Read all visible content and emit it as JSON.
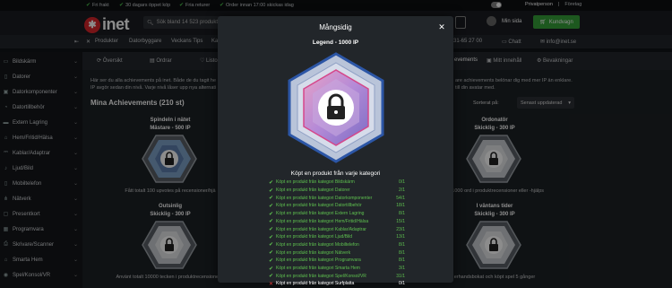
{
  "promo": {
    "items": [
      "Fri frakt",
      "30 dagars öppet köp",
      "Fria returer",
      "Order innan 17:00 skickas idag"
    ],
    "right": [
      "Privatperson",
      "Företag"
    ]
  },
  "header": {
    "logo_text": "inet",
    "search_placeholder": "Sök bland 14 523 produkt",
    "my_page": "Min sida",
    "cart_label": "Kundvagn"
  },
  "navbar": {
    "items": [
      "Produkter",
      "Datorbyggare",
      "Veckans Tips",
      "Ka"
    ],
    "phone": "31-65 27 00",
    "chat": "Chatt",
    "email": "info@inet.se"
  },
  "sidebar": {
    "items": [
      {
        "label": "Bildskärm",
        "icon": "monitor-icon"
      },
      {
        "label": "Datorer",
        "icon": "computer-icon"
      },
      {
        "label": "Datorkomponenter",
        "icon": "cpu-icon"
      },
      {
        "label": "Datortillbehör",
        "icon": "mouse-icon"
      },
      {
        "label": "Extern Lagring",
        "icon": "drive-icon"
      },
      {
        "label": "Hem/Fritid/Hälsa",
        "icon": "home-icon"
      },
      {
        "label": "Kablar/Adaptrar",
        "icon": "cable-icon"
      },
      {
        "label": "Ljud/Bild",
        "icon": "speaker-icon"
      },
      {
        "label": "Mobiltelefon",
        "icon": "phone-icon"
      },
      {
        "label": "Nätverk",
        "icon": "network-icon"
      },
      {
        "label": "Presentkort",
        "icon": "gift-icon"
      },
      {
        "label": "Programvara",
        "icon": "software-icon"
      },
      {
        "label": "Skrivare/Scanner",
        "icon": "printer-icon"
      },
      {
        "label": "Smarta Hem",
        "icon": "smart-home-icon"
      },
      {
        "label": "Spel/Konsol/VR",
        "icon": "gamepad-icon"
      }
    ]
  },
  "tabs": {
    "overview": "Översikt",
    "orders": "Ordrar",
    "wishlist": "Listo",
    "achievements": "evements",
    "my_content": "Mitt innehåll",
    "watch": "Bevakningar"
  },
  "main": {
    "intro_left_1": "Här ser du alla achievements på inet. Både de du tagit he",
    "intro_left_2": "IP avgör sedan din nivå. Varje nivå låser upp nya alternati",
    "intro_right_1": "are achievements belönar dig med mer IP än enklare.",
    "intro_right_2": "till din avatar med.",
    "heading": "Mina Achievements (210 st)",
    "sort_label": "Sorterat på:",
    "sort_value": "Senast uppdaterad"
  },
  "cards": [
    {
      "title": "Spindeln i nätet",
      "level": "Mästare - 500 IP",
      "desc": "Fått totalt 100 upvotes på recensioner/hjä"
    },
    {
      "title": "Ordonatör",
      "level": "Skicklig - 300 IP",
      "desc": "ök 1000 ord i produktrecensioner eller -hjälps"
    },
    {
      "title": "Outsinlig",
      "level": "Skicklig - 300 IP",
      "desc": "Använt totalt 10000 tecken i produktrecensioner e"
    },
    {
      "title": "I väntans tider",
      "level": "Skicklig - 300 IP",
      "desc": "erhandsbokat och köpt spel 5 gånger"
    }
  ],
  "modal": {
    "title": "Mångsidig",
    "subtitle": "Legend - 1000 IP",
    "description": "Köpt en produkt från varje kategori",
    "requirements": [
      {
        "label": "Köpt en produkt från kategori Bildskärm",
        "count": "0/1",
        "done": true
      },
      {
        "label": "Köpt en produkt från kategori Datorer",
        "count": "2/1",
        "done": true
      },
      {
        "label": "Köpt en produkt från kategori Datorkomponenter",
        "count": "54/1",
        "done": true
      },
      {
        "label": "Köpt en produkt från kategori Datortillbehör",
        "count": "18/1",
        "done": true
      },
      {
        "label": "Köpt en produkt från kategori Extern Lagring",
        "count": "8/1",
        "done": true
      },
      {
        "label": "Köpt en produkt från kategori Hem/Fritid/Hälsa",
        "count": "15/1",
        "done": true
      },
      {
        "label": "Köpt en produkt från kategori Kablar/Adaptrar",
        "count": "23/1",
        "done": true
      },
      {
        "label": "Köpt en produkt från kategori Ljud/Bild",
        "count": "13/1",
        "done": true
      },
      {
        "label": "Köpt en produkt från kategori Mobiltelefon",
        "count": "8/1",
        "done": true
      },
      {
        "label": "Köpt en produkt från kategori Nätverk",
        "count": "8/1",
        "done": true
      },
      {
        "label": "Köpt en produkt från kategori Programvara",
        "count": "8/1",
        "done": true
      },
      {
        "label": "Köpt en produkt från kategori Smarta Hem",
        "count": "3/1",
        "done": true
      },
      {
        "label": "Köpt en produkt från kategori Spel/Konsol/VR",
        "count": "31/1",
        "done": true
      },
      {
        "label": "Köpt en produkt från kategori Surfplatta",
        "count": "0/1",
        "done": false
      }
    ]
  },
  "colors": {
    "accent_green": "#36a03a",
    "done_green": "#5ec04f",
    "fail_red": "#e53a3a",
    "logo_red": "#d9262b"
  }
}
